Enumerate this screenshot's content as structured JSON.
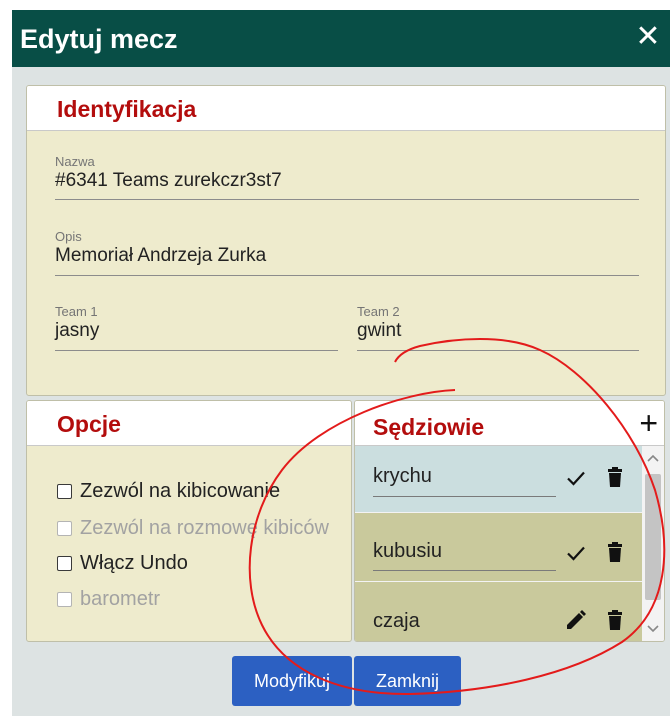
{
  "dialog": {
    "title": "Edytuj mecz",
    "close_symbol": "✕"
  },
  "identification": {
    "title": "Identyfikacja",
    "name_label": "Nazwa",
    "name_value": "#6341 Teams zurekczr3st7",
    "desc_label": "Opis",
    "desc_value": "Memoriał Andrzeja Zurka",
    "team1_label": "Team 1",
    "team1_value": "jasny",
    "team2_label": "Team 2",
    "team2_value": "gwint"
  },
  "options": {
    "title": "Opcje",
    "items": [
      {
        "label": "Zezwól na kibicowanie",
        "enabled": true,
        "checked": false
      },
      {
        "label": "Zezwól na rozmowę kibiców",
        "enabled": false,
        "checked": false
      },
      {
        "label": "Włącz Undo",
        "enabled": true,
        "checked": false
      },
      {
        "label": "barometr",
        "enabled": false,
        "checked": false
      }
    ]
  },
  "referees": {
    "title": "Sędziowie",
    "add_symbol": "+",
    "items": [
      {
        "name": "krychu",
        "action": "check-icon"
      },
      {
        "name": "kubusiu",
        "action": "check-icon"
      },
      {
        "name": "czaja",
        "action": "pencil-icon"
      }
    ]
  },
  "buttons": {
    "modify": "Modyfikuj",
    "close": "Zamknij"
  },
  "colors": {
    "header_bg": "#084e46",
    "section_title": "#b30d0d",
    "panel_bg": "#eeebcd",
    "referee_row_light": "#cbdedf",
    "referee_row_olive": "#c9c99c",
    "button_bg": "#2c60c2",
    "annotation": "#e31b1b"
  }
}
